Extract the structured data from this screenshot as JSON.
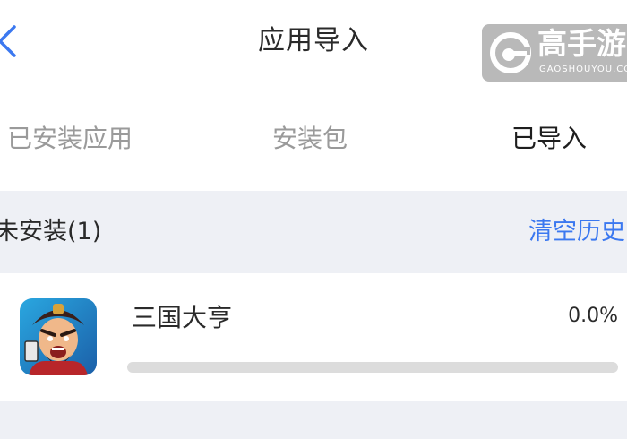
{
  "header": {
    "title": "应用导入",
    "back_icon": "back-arrow-icon",
    "back_color": "#3b78f0"
  },
  "watermark": {
    "brand": "高手游",
    "domain": "GAOSHOUYOU.COM"
  },
  "tabs": [
    {
      "label": "已安装应用",
      "active": false
    },
    {
      "label": "安装包",
      "active": false
    },
    {
      "label": "已导入",
      "active": true
    }
  ],
  "section": {
    "title": "未安装(1)",
    "clear_label": "清空历史"
  },
  "apps": [
    {
      "name": "三国大亨",
      "progress_text": "0.0%",
      "progress": 0.0
    }
  ],
  "colors": {
    "accent": "#3b78f0",
    "section_bg": "#eef0f5",
    "inactive_tab": "#9a9a9a",
    "track": "#dcdcdc"
  }
}
